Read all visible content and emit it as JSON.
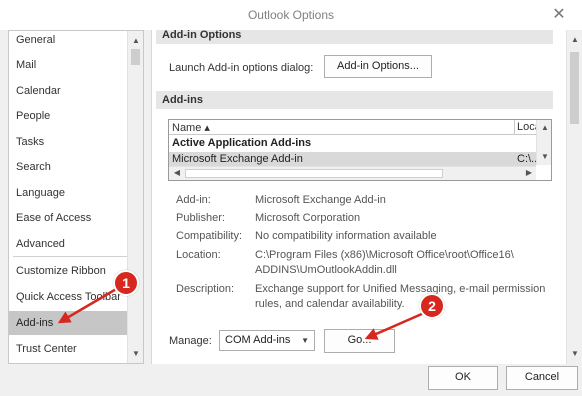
{
  "window": {
    "title": "Outlook Options",
    "close_glyph": "✕"
  },
  "nav": {
    "items": [
      {
        "label": "General"
      },
      {
        "label": "Mail"
      },
      {
        "label": "Calendar"
      },
      {
        "label": "People"
      },
      {
        "label": "Tasks"
      },
      {
        "label": "Search"
      },
      {
        "label": "Language"
      },
      {
        "label": "Ease of Access"
      },
      {
        "label": "Advanced"
      },
      {
        "label": "Customize Ribbon"
      },
      {
        "label": "Quick Access Toolbar"
      },
      {
        "label": "Add-ins",
        "selected": true
      },
      {
        "label": "Trust Center"
      }
    ]
  },
  "main": {
    "addin_options_section": {
      "header": "Add-in Options",
      "launch_label": "Launch Add-in options dialog:",
      "button_label": "Add-in Options..."
    },
    "addins_section": {
      "header": "Add-ins",
      "grid": {
        "col_name": "Name ▴",
        "col_location": "Loca",
        "group_label": "Active Application Add-ins",
        "selected_name": "Microsoft Exchange Add-in",
        "selected_location": "C:\\..."
      },
      "details": {
        "addin_label": "Add-in:",
        "addin_value": "Microsoft Exchange Add-in",
        "publisher_label": "Publisher:",
        "publisher_value": "Microsoft Corporation",
        "compat_label": "Compatibility:",
        "compat_value": "No compatibility information available",
        "location_label": "Location:",
        "location_line1": "C:\\Program Files (x86)\\Microsoft Office\\root\\Office16\\",
        "location_line2": "ADDINS\\UmOutlookAddin.dll",
        "description_label": "Description:",
        "description_line1": "Exchange support for Unified Messaging, e-mail permission",
        "description_line2": "rules, and calendar availability."
      },
      "manage": {
        "label": "Manage:",
        "selected_option": "COM Add-ins",
        "go_label": "Go..."
      }
    }
  },
  "footer": {
    "ok_label": "OK",
    "cancel_label": "Cancel"
  },
  "callouts": {
    "one": "1",
    "two": "2",
    "color": "#d6281f"
  },
  "icons": {
    "scroll_up": "▲",
    "scroll_down": "▼",
    "scroll_left": "◀",
    "scroll_right": "▶",
    "dropdown": "▼"
  }
}
